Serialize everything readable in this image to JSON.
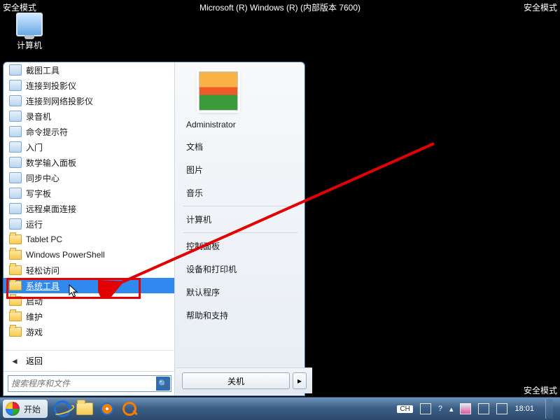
{
  "safemode": {
    "left": "安全模式",
    "center": "Microsoft (R) Windows (R) (内部版本 7600)",
    "right": "安全模式",
    "bottom_right": "安全模式"
  },
  "desktop": {
    "computer_label": "计算机"
  },
  "start_menu": {
    "items": [
      {
        "label": "截图工具",
        "icon": "gen"
      },
      {
        "label": "连接到投影仪",
        "icon": "gen"
      },
      {
        "label": "连接到网络投影仪",
        "icon": "gen"
      },
      {
        "label": "录音机",
        "icon": "gen"
      },
      {
        "label": "命令提示符",
        "icon": "gen"
      },
      {
        "label": "入门",
        "icon": "gen"
      },
      {
        "label": "数学输入面板",
        "icon": "gen"
      },
      {
        "label": "同步中心",
        "icon": "gen"
      },
      {
        "label": "写字板",
        "icon": "gen"
      },
      {
        "label": "远程桌面连接",
        "icon": "gen"
      },
      {
        "label": "运行",
        "icon": "gen"
      },
      {
        "label": "Tablet PC",
        "icon": "folder"
      },
      {
        "label": "Windows PowerShell",
        "icon": "folder"
      },
      {
        "label": "轻松访问",
        "icon": "folder"
      },
      {
        "label": "系统工具",
        "icon": "folder",
        "highlight": true
      },
      {
        "label": "启动",
        "icon": "folder"
      },
      {
        "label": "维护",
        "icon": "folder"
      },
      {
        "label": "游戏",
        "icon": "folder"
      }
    ],
    "back_label": "返回",
    "search_placeholder": "搜索程序和文件",
    "right_panel": {
      "user": "Administrator",
      "links": [
        "文档",
        "图片",
        "音乐",
        "计算机",
        "控制面板",
        "设备和打印机",
        "默认程序",
        "帮助和支持"
      ]
    },
    "shutdown_label": "关机"
  },
  "taskbar": {
    "start_label": "开始",
    "ime": "CH",
    "clock_time": "18:01"
  }
}
